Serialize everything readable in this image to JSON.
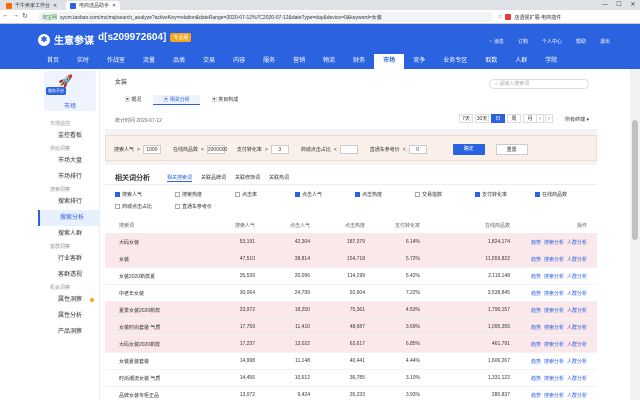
{
  "browser": {
    "tabs": [
      "千牛卖家工作台",
      "电商选品助手"
    ],
    "url": "sycm.taobao.com/mc/mq/search_analyze?activeKey=relation&dateRange=2020-07-12%7C2020-07-12&dateType=day&device=0&keyword=女装",
    "secure_label": "淘宝网",
    "ext_label": "店透视扩展-电商插件",
    "win": [
      "—",
      "☐",
      "✕"
    ]
  },
  "header": {
    "logo_mark": "✱",
    "title": "生意参谋",
    "shop": "d[s209972604]",
    "badge": "专业版",
    "right": [
      "消息",
      "订购",
      "个人中心",
      "帮助",
      "退出"
    ],
    "nav": [
      "首页",
      "实时",
      "作战室",
      "流量",
      "品类",
      "交易",
      "内容",
      "服务",
      "营销",
      "物流",
      "财务",
      "市场",
      "竞争",
      "业务专区",
      "取数",
      "人群",
      "学院"
    ],
    "nav_active": "市场"
  },
  "sidebar": {
    "hero_tag": "服务开启",
    "hero_label": "市场",
    "sections": [
      {
        "title": "市场监控",
        "items": [
          {
            "label": "监控看板"
          }
        ]
      },
      {
        "title": "供给洞察",
        "items": [
          {
            "label": "市场大盘"
          },
          {
            "label": "市场排行"
          }
        ]
      },
      {
        "title": "搜索洞察",
        "items": [
          {
            "label": "搜索排行"
          },
          {
            "label": "搜索分析",
            "active": true
          },
          {
            "label": "搜索人群"
          }
        ]
      },
      {
        "title": "客群洞察",
        "items": [
          {
            "label": "行业客群"
          },
          {
            "label": "客群透视"
          }
        ]
      },
      {
        "title": "机会洞察",
        "items": [
          {
            "label": "属性洞察",
            "dot": true
          },
          {
            "label": "属性分析"
          },
          {
            "label": "产品洞察"
          }
        ]
      }
    ]
  },
  "main": {
    "category": "女装",
    "search_placeholder": "请输入搜索词",
    "subtabs": [
      "概况",
      "相关分析",
      "类目构成"
    ],
    "subtab_active": "相关分析",
    "date_text": "统计时间 2020-07-12",
    "date_buttons": [
      "7天",
      "30天",
      "日",
      "周",
      "月"
    ],
    "date_active": "日",
    "terminal": "所有终端",
    "filters": [
      {
        "label": "搜索人气",
        "op": ">",
        "value": "1000"
      },
      {
        "label": "在线商品数",
        "op": "<",
        "value": "2000000"
      },
      {
        "label": "支付转化率",
        "op": ">",
        "value": "3"
      },
      {
        "label": "商城点击占比",
        "op": "<",
        "value": ""
      },
      {
        "label": "直通车参考价",
        "op": "<",
        "value": "0"
      }
    ],
    "btn_confirm": "确定",
    "btn_reset": "重置",
    "analysis_title": "相关词分析",
    "analysis_tabs": [
      "相关搜索词",
      "关联品牌词",
      "关联修饰词",
      "关联热词"
    ],
    "analysis_tab_active": "相关搜索词",
    "checks": [
      {
        "label": "搜索人气",
        "on": true
      },
      {
        "label": "搜索热度",
        "on": false
      },
      {
        "label": "点击率",
        "on": false
      },
      {
        "label": "点击人气",
        "on": true
      },
      {
        "label": "点击热度",
        "on": true
      },
      {
        "label": "交易指数",
        "on": false
      },
      {
        "label": "支付转化率",
        "on": true
      },
      {
        "label": "在线商品数",
        "on": true
      },
      {
        "label": "商城点击占比",
        "on": false
      },
      {
        "label": "直通车参考价",
        "on": false
      }
    ],
    "columns": [
      "搜索词",
      "搜索人气",
      "点击人气",
      "点击热度",
      "支付转化率",
      "在线商品数",
      "操作"
    ],
    "row_actions": [
      "趋势",
      "搜索分析",
      "人群分析"
    ],
    "rows": [
      {
        "term": "大码女装",
        "v1": "53,191",
        "v2": "42,304",
        "v3": "187,379",
        "v4": "6.14%",
        "v5": "1,824,174",
        "pink": true
      },
      {
        "term": "女装",
        "v1": "47,510",
        "v2": "38,814",
        "v3": "154,718",
        "v4": "5.72%",
        "v5": "11,659,822",
        "pink": true
      },
      {
        "term": "女装2020新款夏",
        "v1": "35,539",
        "v2": "20,096",
        "v3": "114,299",
        "v4": "5.42%",
        "v5": "2,119,148",
        "pink": false
      },
      {
        "term": "中老年女装",
        "v1": "30,064",
        "v2": "24,799",
        "v3": "92,604",
        "v4": "7.22%",
        "v5": "3,538,845",
        "pink": false
      },
      {
        "term": "夏季女装2020新款",
        "v1": "23,972",
        "v2": "18,250",
        "v3": "75,361",
        "v4": "4.53%",
        "v5": "1,790,157",
        "pink": true
      },
      {
        "term": "女装时尚套装 气质",
        "v1": "17,759",
        "v2": "11,410",
        "v3": "48,687",
        "v4": "3.69%",
        "v5": "1,095,355",
        "pink": true
      },
      {
        "term": "大码女装2020新款",
        "v1": "17,237",
        "v2": "13,022",
        "v3": "62,617",
        "v4": "6.85%",
        "v5": "461,791",
        "pink": true
      },
      {
        "term": "女装夏装套装",
        "v1": "14,998",
        "v2": "11,148",
        "v3": "40,441",
        "v4": "4.44%",
        "v5": "1,606,267",
        "pink": false
      },
      {
        "term": "时尚潮流女装 气质",
        "v1": "14,456",
        "v2": "10,612",
        "v3": "36,785",
        "v4": "3.10%",
        "v5": "1,331,122",
        "pink": false
      },
      {
        "term": "品牌女装专柜正品",
        "v1": "13,072",
        "v2": "9,424",
        "v3": "35,233",
        "v4": "3.93%",
        "v5": "280,837",
        "pink": false
      }
    ]
  }
}
